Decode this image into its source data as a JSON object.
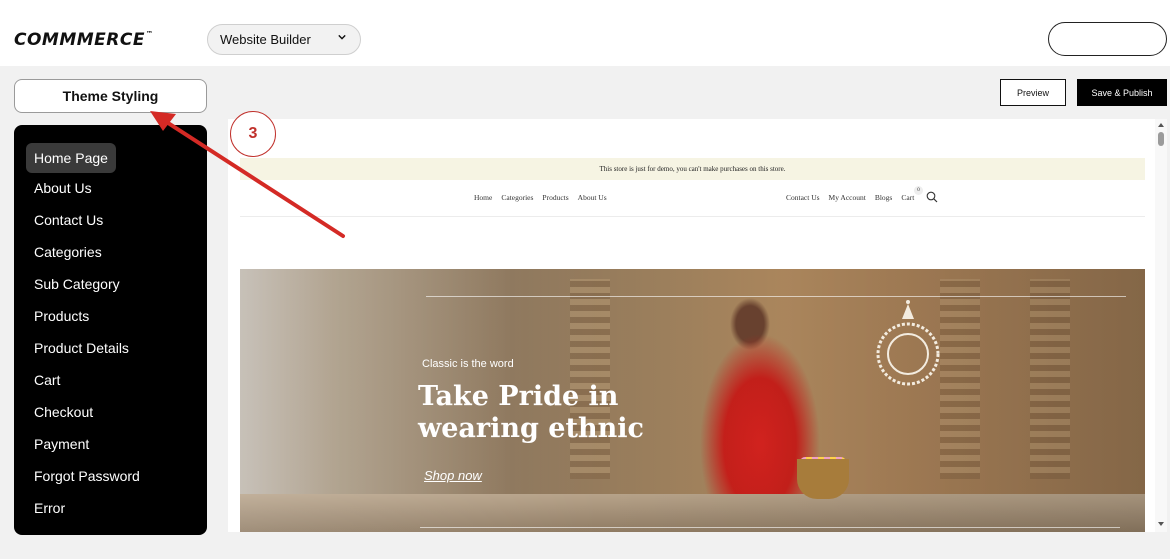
{
  "header": {
    "logo_text": "COMMMERCE",
    "logo_tm": "™",
    "builder_select_value": "Website Builder"
  },
  "toolbar": {
    "theme_styling_label": "Theme Styling",
    "preview_label": "Preview",
    "publish_label": "Save & Publish"
  },
  "sidebar": {
    "items": [
      {
        "label": "Home Page",
        "active": true
      },
      {
        "label": "About Us"
      },
      {
        "label": "Contact Us"
      },
      {
        "label": "Categories"
      },
      {
        "label": "Sub Category"
      },
      {
        "label": "Products"
      },
      {
        "label": "Product Details"
      },
      {
        "label": "Cart"
      },
      {
        "label": "Checkout"
      },
      {
        "label": "Payment"
      },
      {
        "label": "Forgot Password"
      },
      {
        "label": "Error"
      }
    ]
  },
  "annotation": {
    "step_number": "3",
    "color": "#c0302b"
  },
  "store_preview": {
    "notice": "This store is just for demo, you can't make purchases on this store.",
    "nav_left": [
      "Home",
      "Categories",
      "Products",
      "About Us"
    ],
    "nav_right": [
      "Contact Us",
      "My Account",
      "Blogs",
      "Cart"
    ],
    "cart_count": "0",
    "hero": {
      "subtitle": "Classic is the word",
      "title": "Take Pride in wearing ethnic",
      "cta": "Shop now"
    }
  }
}
